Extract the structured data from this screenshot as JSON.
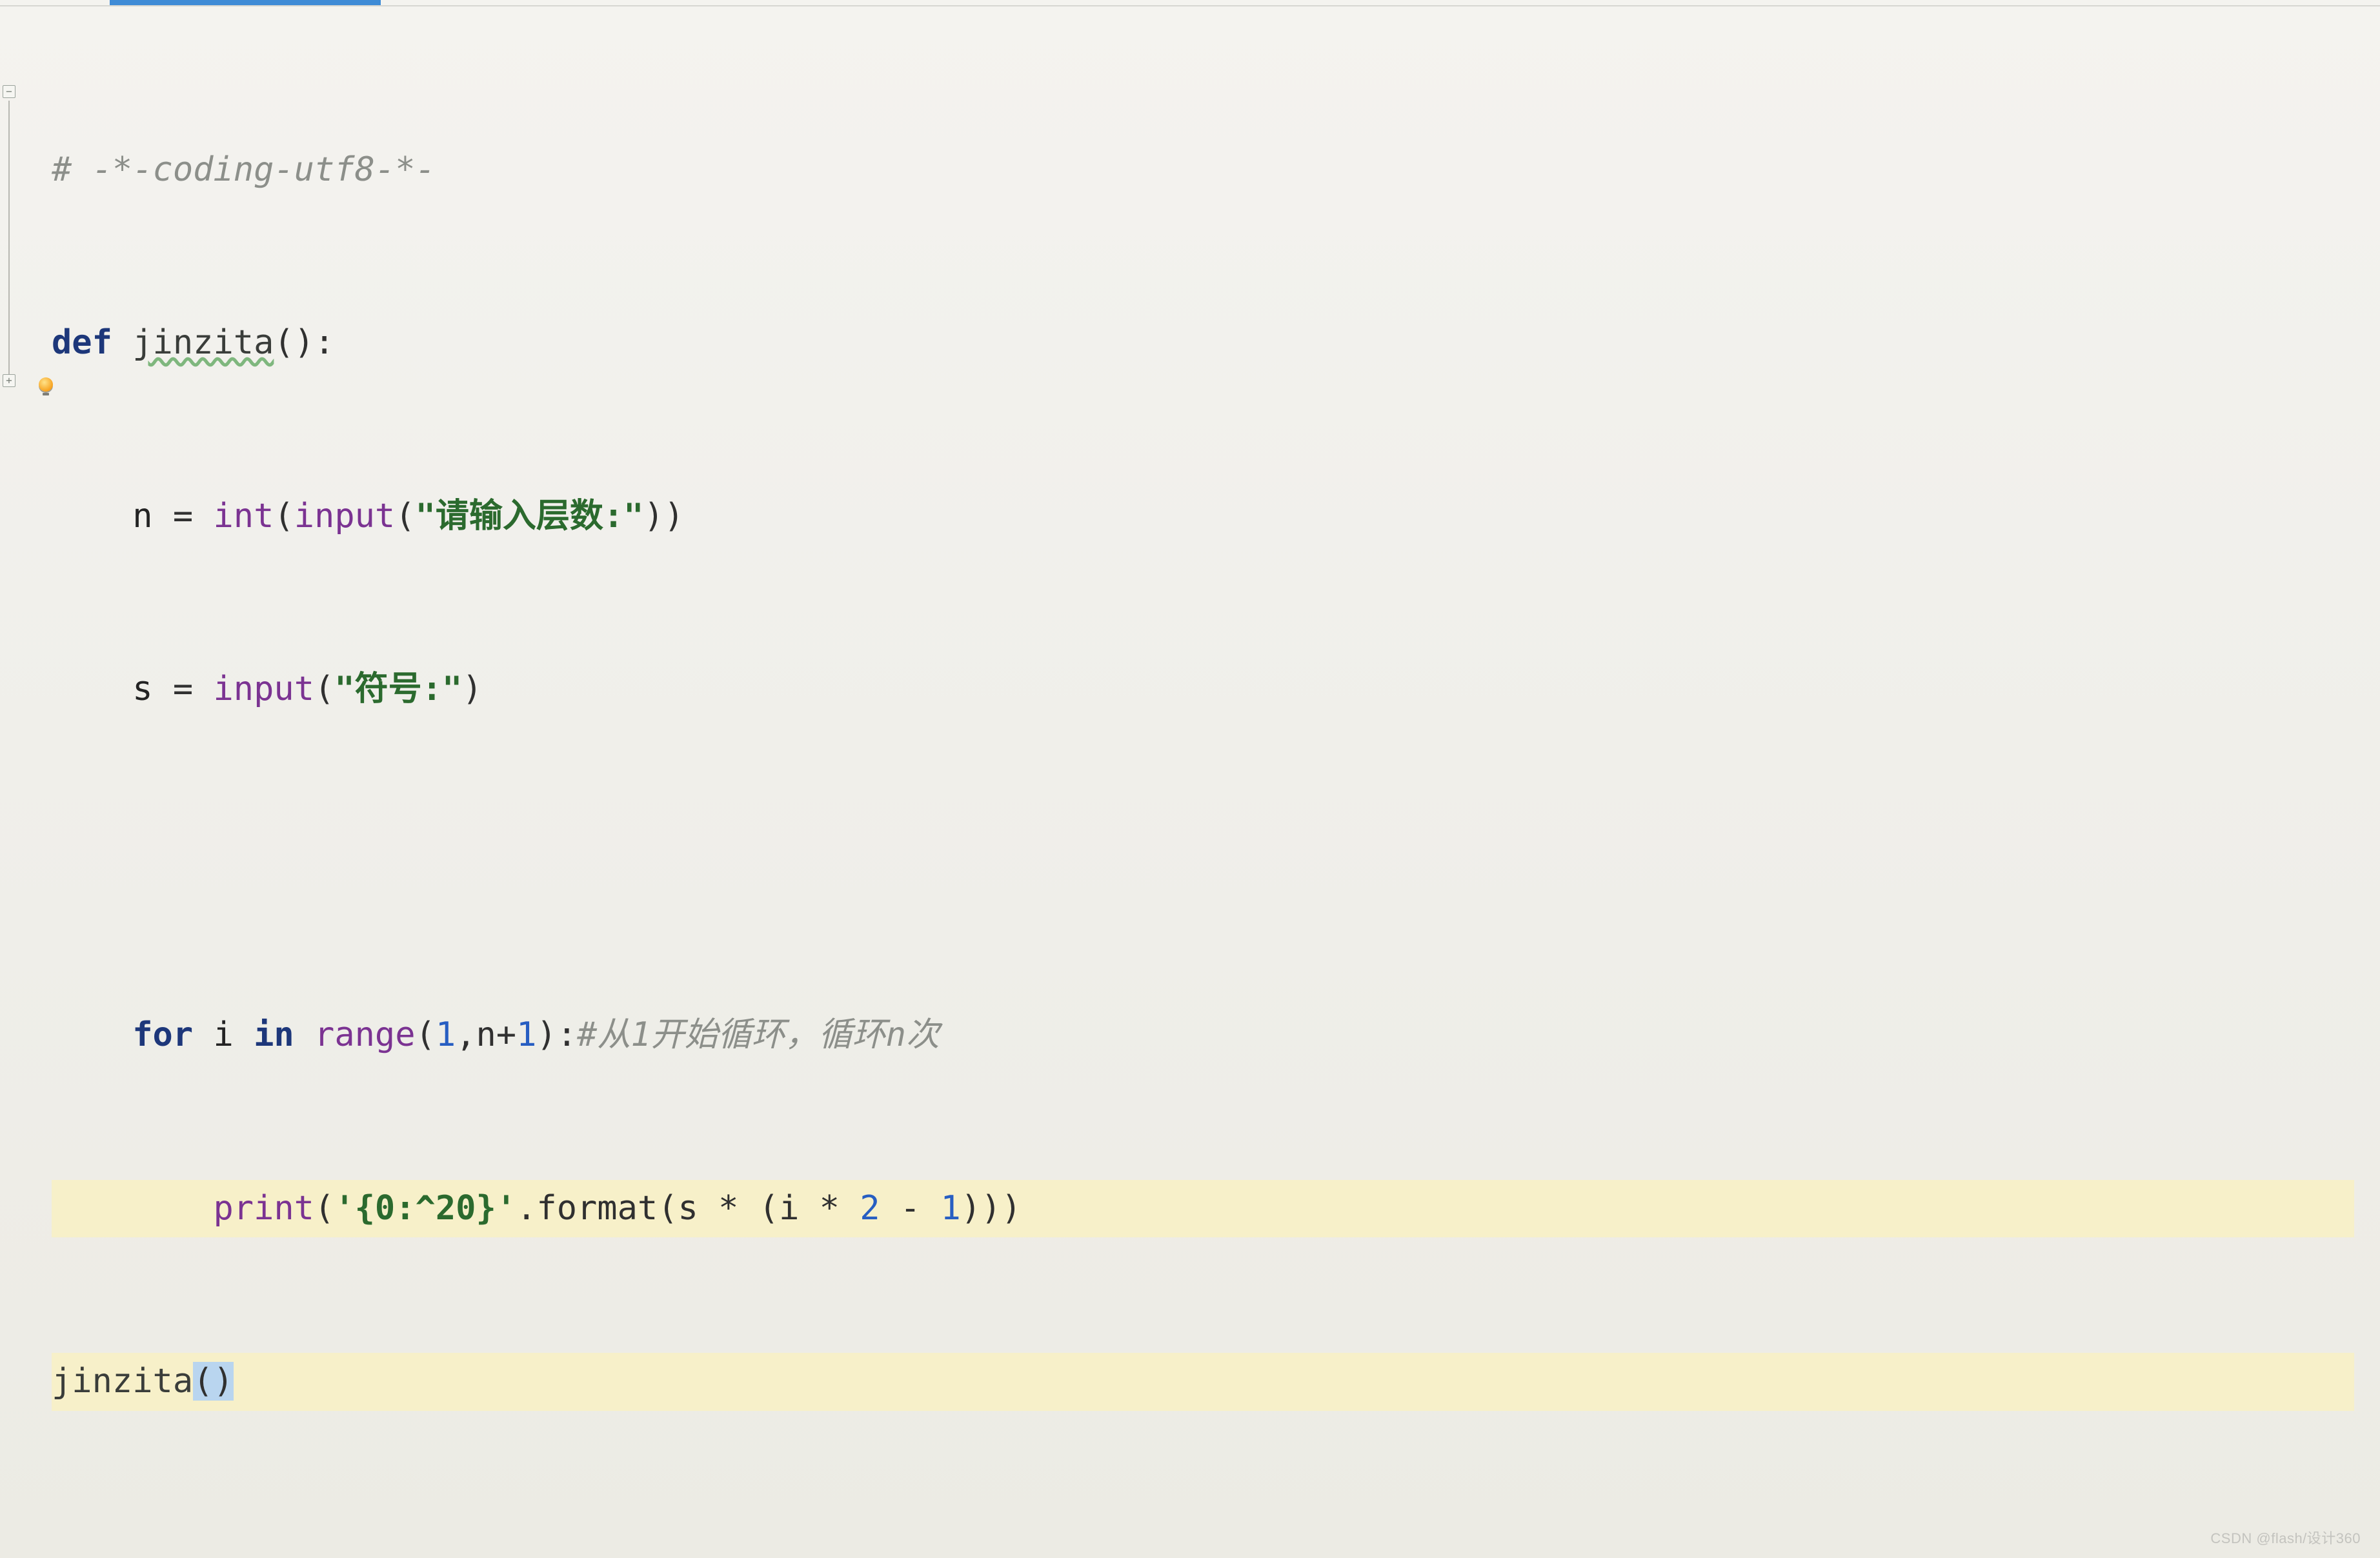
{
  "code": {
    "l1_comment": "# -*-coding-utf8-*-",
    "l2_def": "def",
    "l2_name": "jinzita",
    "l2_tail": "():",
    "l3_n": "n",
    "l3_eq": " = ",
    "l3_int": "int",
    "l3_p1": "(",
    "l3_input": "input",
    "l3_p2": "(",
    "l3_str": "\"请输入层数:\"",
    "l3_close": "))",
    "l4_s": "s",
    "l4_eq": " = ",
    "l4_input": "input",
    "l4_p1": "(",
    "l4_str": "\"符号:\"",
    "l4_close": ")",
    "l6_for": "for",
    "l6_i": " i ",
    "l6_in": "in",
    "l6_sp": " ",
    "l6_range": "range",
    "l6_p1": "(",
    "l6_1": "1",
    "l6_comma": ",n+",
    "l6_1b": "1",
    "l6_p2": "):",
    "l6_cmt": "#从1开始循环，循环n次",
    "l7_print": "print",
    "l7_p1": "(",
    "l7_str": "'{0:^20}'",
    "l7_dot": ".format(s * (i * ",
    "l7_2": "2",
    "l7_mid": " - ",
    "l7_1": "1",
    "l7_close": ")))",
    "l8_call": "jinzita",
    "l8_parens": "()"
  },
  "watermark": "CSDN @flash/设计360"
}
